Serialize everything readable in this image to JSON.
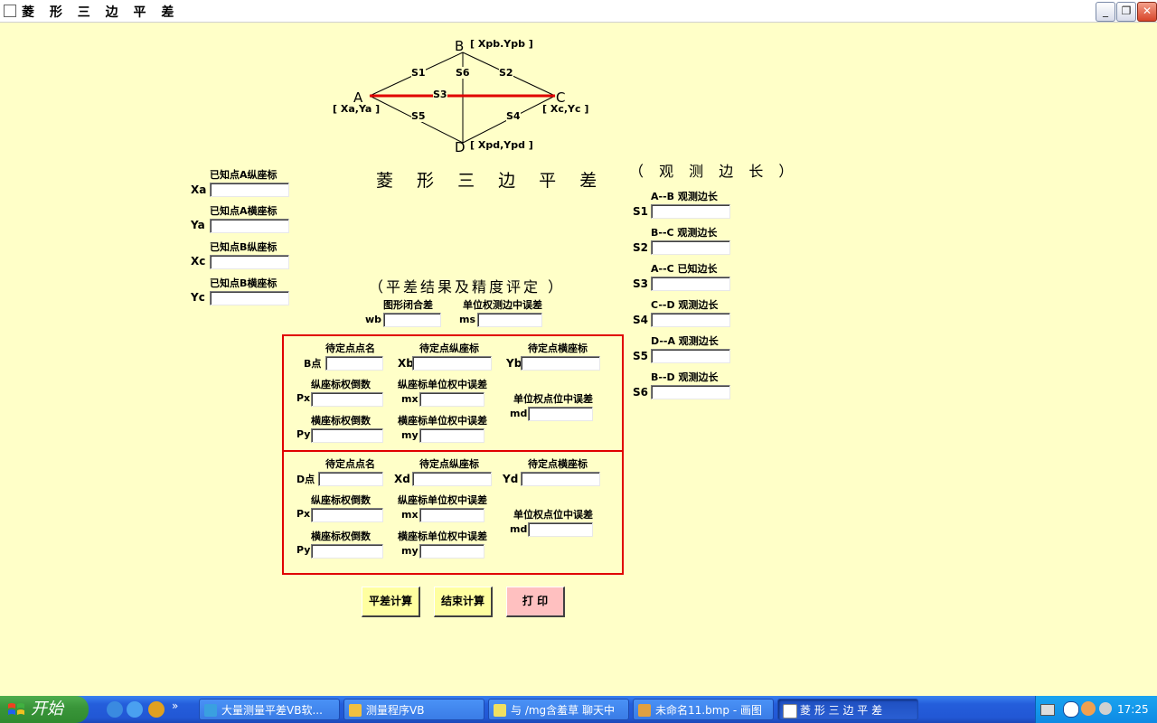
{
  "window": {
    "title": "菱 形 三 边 平 差"
  },
  "diagram": {
    "points": {
      "A": "A",
      "B": "B",
      "C": "C",
      "D": "D"
    },
    "coords": {
      "A": "[ Xa,Ya ]",
      "B": "[ Xpb.Ypb ]",
      "C": "[ Xc,Yc ]",
      "D": "[ Xpd,Ypd ]"
    },
    "sides": {
      "s1": "S1",
      "s2": "S2",
      "s3": "S3",
      "s4": "S4",
      "s5": "S5",
      "s6": "S6"
    },
    "colors": {
      "lines": "#000000",
      "known_side": "#e00000"
    }
  },
  "main_title": "菱 形 三 边 平 差",
  "known_points": {
    "xa": {
      "caption": "已知点A纵座标",
      "label": "Xa",
      "value": ""
    },
    "ya": {
      "caption": "已知点A横座标",
      "label": "Ya",
      "value": ""
    },
    "xc": {
      "caption": "已知点B纵座标",
      "label": "Xc",
      "value": ""
    },
    "yc": {
      "caption": "已知点B横座标",
      "label": "Yc",
      "value": ""
    }
  },
  "observed": {
    "heading": "（ 观 测 边 长 ）",
    "items": [
      {
        "caption": "A--B 观测边长",
        "label": "S1",
        "value": ""
      },
      {
        "caption": "B--C 观测边长",
        "label": "S2",
        "value": ""
      },
      {
        "caption": "A--C 已知边长",
        "label": "S3",
        "value": ""
      },
      {
        "caption": "C--D 观测边长",
        "label": "S4",
        "value": ""
      },
      {
        "caption": "D--A 观测边长",
        "label": "S5",
        "value": ""
      },
      {
        "caption": "B--D 观测边长",
        "label": "S6",
        "value": ""
      }
    ]
  },
  "results": {
    "heading": "（平差结果及精度评定 ）",
    "wb": {
      "caption": "图形闭合差",
      "label": "wb",
      "value": ""
    },
    "ms": {
      "caption": "单位权测边中误差",
      "label": "ms",
      "value": ""
    }
  },
  "point_b": {
    "name_caption": "待定点点名",
    "name_label": "B点",
    "x_caption": "待定点纵座标",
    "x_label": "Xb",
    "y_caption": "待定点横座标",
    "y_label": "Yb",
    "px_caption": "纵座标权倒数",
    "px_label": "Px",
    "mx_caption": "纵座标单位权中误差",
    "mx_label": "mx",
    "md_caption": "单位权点位中误差",
    "md_label": "md",
    "py_caption": "横座标权倒数",
    "py_label": "Py",
    "my_caption": "横座标单位权中误差",
    "my_label": "my"
  },
  "point_d": {
    "name_caption": "待定点点名",
    "name_label": "D点",
    "x_caption": "待定点纵座标",
    "x_label": "Xd",
    "y_caption": "待定点横座标",
    "y_label": "Yd",
    "px_caption": "纵座标权倒数",
    "px_label": "Px",
    "mx_caption": "纵座标单位权中误差",
    "mx_label": "mx",
    "md_caption": "单位权点位中误差",
    "md_label": "md",
    "py_caption": "横座标权倒数",
    "py_label": "Py",
    "my_caption": "横座标单位权中误差",
    "my_label": "my"
  },
  "buttons": {
    "compute": {
      "label": "平差计算",
      "color": "#ffffa0"
    },
    "finish": {
      "label": "结束计算",
      "color": "#ffffa0"
    },
    "print": {
      "label": "打 印",
      "color": "#ffc0c0"
    }
  },
  "taskbar": {
    "start": "开始",
    "tasks": [
      {
        "label": "大量测量平差VB软...",
        "icon_color": "#3aa0e0"
      },
      {
        "label": "测量程序VB",
        "icon_color": "#f0c040"
      },
      {
        "label": "与 /mg含羞草 聊天中",
        "icon_color": "#f0e060"
      },
      {
        "label": "未命名11.bmp - 画图",
        "icon_color": "#e0a040"
      },
      {
        "label": "菱 形 三 边 平 差",
        "icon_color": "#ffffff"
      }
    ],
    "clock": "17:25"
  }
}
